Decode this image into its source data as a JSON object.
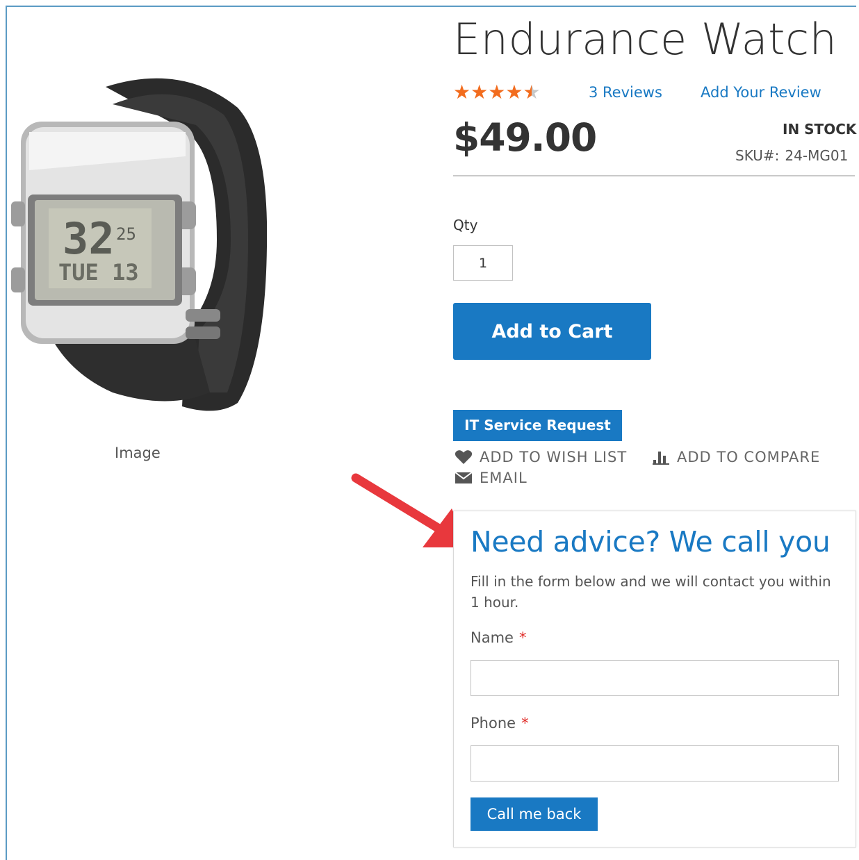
{
  "product": {
    "title": "Endurance Watch",
    "rating_stars": 4.5,
    "rating_max": 5,
    "reviews_link": "3  Reviews",
    "add_review_link": "Add Your Review",
    "price": "$49.00",
    "stock_status": "IN STOCK",
    "sku_label": "SKU#:",
    "sku_value": "24-MG01",
    "image_caption": "Image"
  },
  "purchase": {
    "qty_label": "Qty",
    "qty_value": "1",
    "add_to_cart_label": "Add to Cart"
  },
  "actions": {
    "it_service_label": "IT Service Request",
    "wish_list_label": "ADD TO WISH LIST",
    "compare_label": "ADD TO COMPARE",
    "email_label": "EMAIL"
  },
  "callback": {
    "title": "Need advice? We call you",
    "description": "Fill in the form below and we will contact you within 1 hour.",
    "name_label": "Name",
    "phone_label": "Phone",
    "required_marker": "*",
    "submit_label": "Call me back"
  },
  "colors": {
    "accent": "#1979c3",
    "star": "#f26c1e",
    "required": "#e02b27",
    "annotation_arrow": "#e8383d"
  }
}
